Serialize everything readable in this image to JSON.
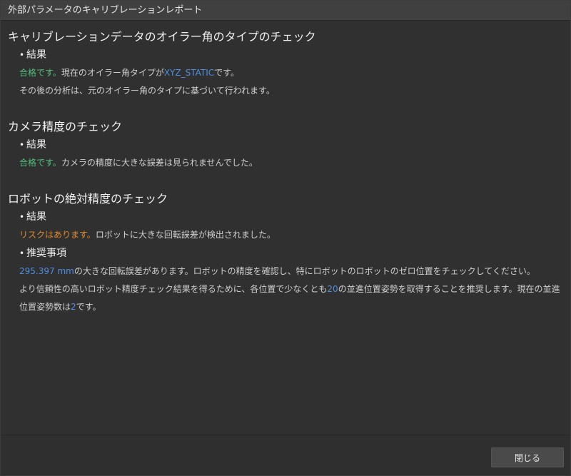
{
  "window": {
    "title": "外部パラメータのキャリブレーションレポート"
  },
  "sections": [
    {
      "title": "キャリブレーションデータのオイラー角のタイプのチェック",
      "result_heading": "結果",
      "result_status": "合格です。",
      "result_text_pre": "現在のオイラー角タイプが",
      "result_value": "XYZ_STATIC",
      "result_text_post": "です。",
      "note": "その後の分析は、元のオイラー角のタイプに基づいて行われます。"
    },
    {
      "title": "カメラ精度のチェック",
      "result_heading": "結果",
      "result_status": "合格です。",
      "result_text": "カメラの精度に大きな誤差は見られませんでした。"
    },
    {
      "title": "ロボットの絶対精度のチェック",
      "result_heading": "結果",
      "result_status": "リスクはあります。",
      "result_text": "ロボットに大きな回転誤差が検出されました。",
      "recommend_heading": "推奨事項",
      "rec1_value": "295.397 mm",
      "rec1_text": "の大きな回転誤差があります。ロボットの精度を確認し、特にロボットのロボットのゼロ位置をチェックしてください。",
      "rec2_pre": "より信頼性の高いロボット精度チェック結果を得るために、各位置で少なくとも",
      "rec2_value1": "20",
      "rec2_mid": "の並進位置姿勢を取得することを推奨します。現在の並進位置姿勢数は",
      "rec2_value2": "2",
      "rec2_post": "です。"
    }
  ],
  "footer": {
    "close_label": "閉じる"
  },
  "colors": {
    "pass": "#4fbf7a",
    "risk": "#e08a2c",
    "value": "#4d8fe0"
  }
}
